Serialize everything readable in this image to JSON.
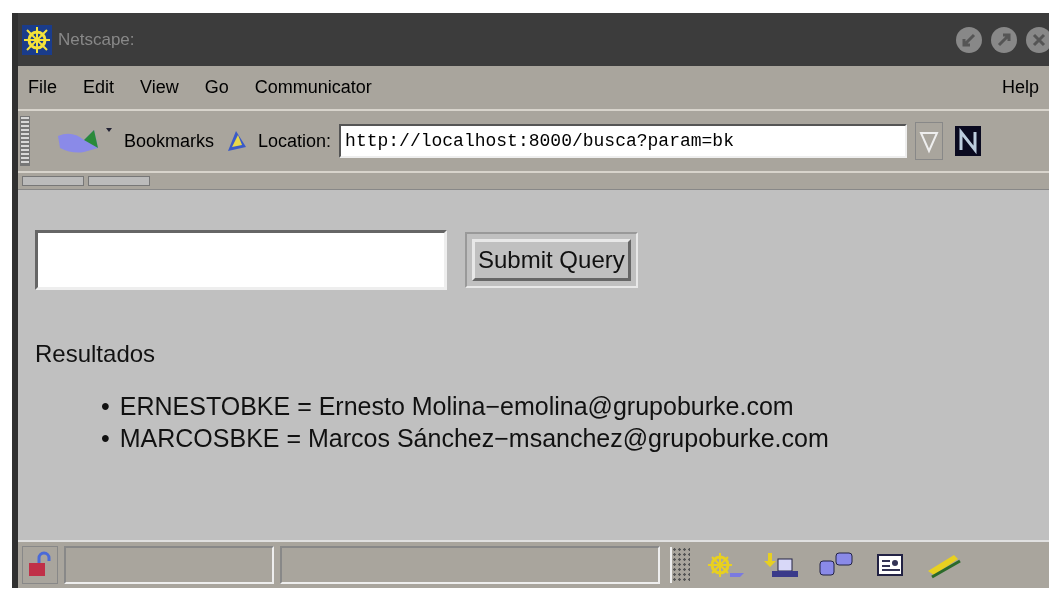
{
  "window": {
    "title": "Netscape:"
  },
  "menu": [
    "File",
    "Edit",
    "View",
    "Go",
    "Communicator"
  ],
  "help_menu": "Help",
  "toolbar": {
    "bookmarks": "Bookmarks",
    "location_label": "Location:",
    "location": "http://localhost:8000/busca?param=bk"
  },
  "form": {
    "submit_label": "Submit Query"
  },
  "heading": "Resultados",
  "results": [
    {
      "bullet": "•",
      "text": "ERNESTOBKE = Ernesto Molina−emolina@grupoburke.com"
    },
    {
      "bullet": "•",
      "text": "MARCOSBKE = Marcos Sánchez−msanchez@grupoburke.com"
    }
  ]
}
